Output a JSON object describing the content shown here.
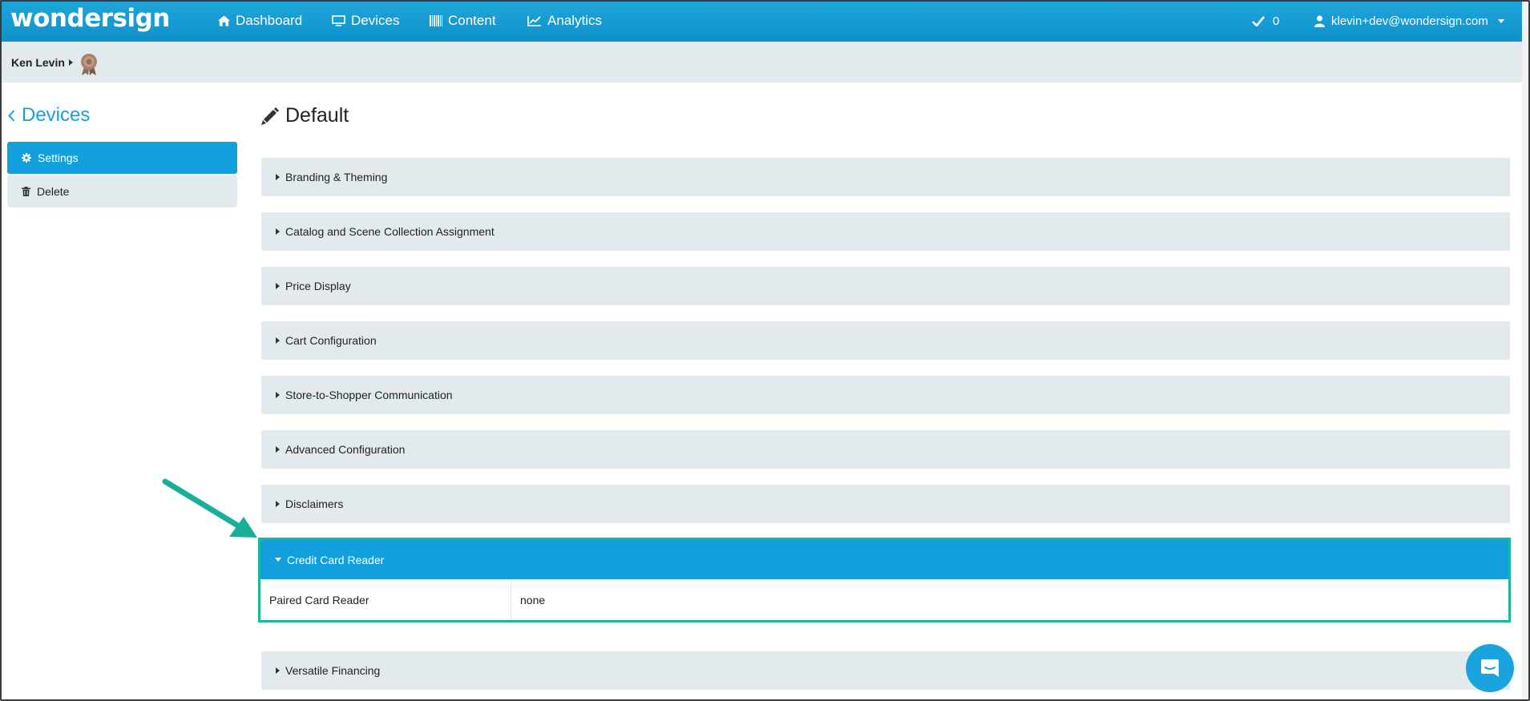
{
  "brand": "wondersign",
  "nav": {
    "dashboard": "Dashboard",
    "devices": "Devices",
    "content": "Content",
    "analytics": "Analytics",
    "check_count": "0",
    "user_email": "klevin+dev@wondersign.com"
  },
  "subbar": {
    "user_name": "Ken Levin"
  },
  "sidebar": {
    "back_label": "Devices",
    "items": [
      {
        "label": "Settings",
        "icon": "gear-icon",
        "active": true
      },
      {
        "label": "Delete",
        "icon": "trash-icon",
        "active": false
      }
    ]
  },
  "main": {
    "title": "Default",
    "panels": [
      {
        "label": "Branding & Theming"
      },
      {
        "label": "Catalog and Scene Collection Assignment"
      },
      {
        "label": "Price Display"
      },
      {
        "label": "Cart Configuration"
      },
      {
        "label": "Store-to-Shopper Communication"
      },
      {
        "label": "Advanced Configuration"
      },
      {
        "label": "Disclaimers"
      },
      {
        "label": "Credit Card Reader",
        "expanded": true
      },
      {
        "label": "Versatile Financing"
      }
    ],
    "credit_card": {
      "row_label": "Paired Card Reader",
      "row_value": "none"
    }
  },
  "colors": {
    "primary": "#12a0dc",
    "panel_bg": "#e3eaee",
    "highlight": "#19b89a"
  }
}
